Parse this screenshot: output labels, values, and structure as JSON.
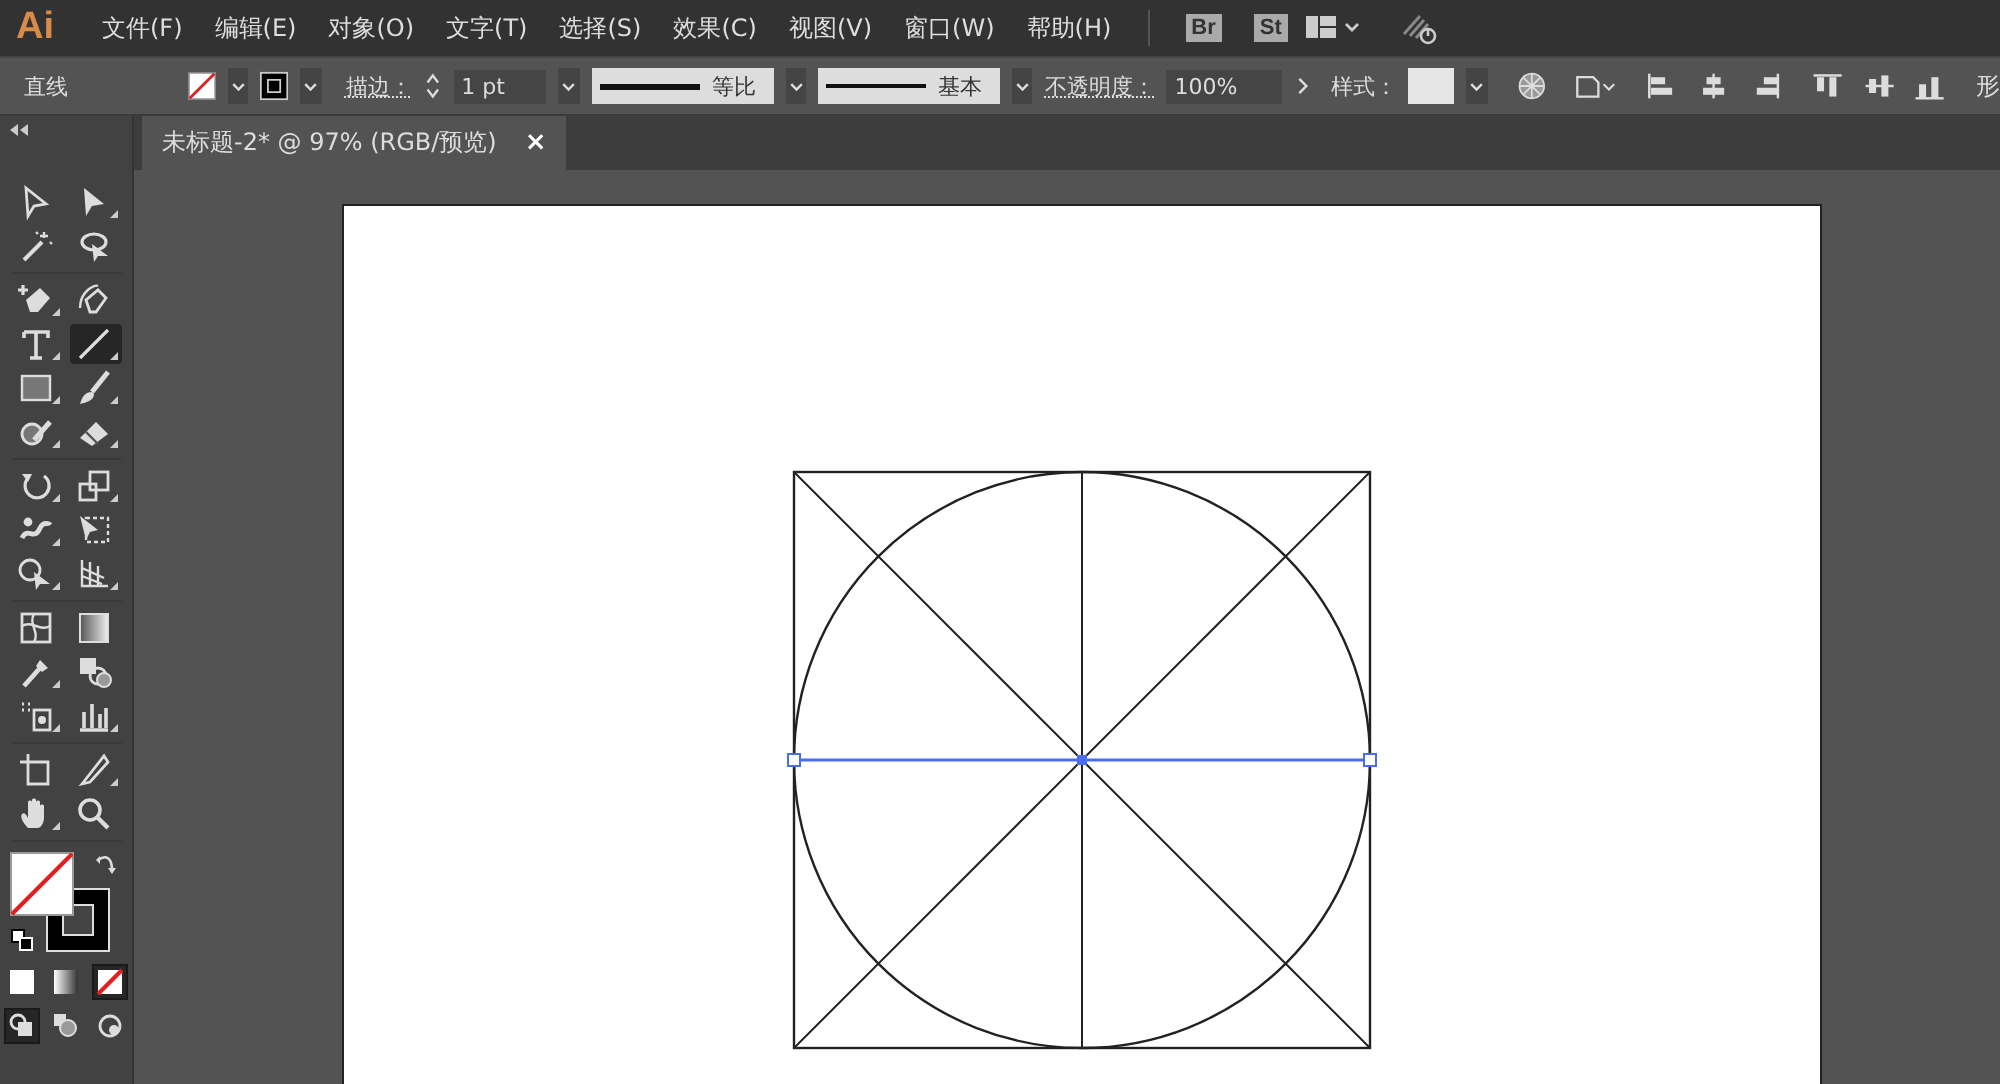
{
  "menubar": {
    "logo": "Ai",
    "menus": [
      "文件(F)",
      "编辑(E)",
      "对象(O)",
      "文字(T)",
      "选择(S)",
      "效果(C)",
      "视图(V)",
      "窗口(W)",
      "帮助(H)"
    ],
    "apps": [
      "Br",
      "St"
    ]
  },
  "control_bar": {
    "tool_name": "直线",
    "fill": {
      "kind": "none"
    },
    "stroke": {
      "kind": "solid"
    },
    "stroke_label": "描边：",
    "stroke_weight": "1 pt",
    "width_profile": "等比",
    "brush": "基本",
    "opacity_label": "不透明度：",
    "opacity": "100%",
    "style_label": "样式：",
    "cut_label": "形"
  },
  "document_tab": {
    "title": "未标题-2* @ 97% (RGB/预览)",
    "close": "×"
  },
  "tool_groups": [
    [
      {
        "kind": "select",
        "selected": false,
        "flyout": false
      },
      {
        "kind": "direct-select",
        "selected": false,
        "flyout": true
      },
      {
        "kind": "wand",
        "selected": false,
        "flyout": false
      },
      {
        "kind": "lasso",
        "selected": false,
        "flyout": false
      }
    ],
    [
      {
        "kind": "pen",
        "selected": false,
        "flyout": true
      },
      {
        "kind": "curvature",
        "selected": false,
        "flyout": false
      },
      {
        "kind": "type",
        "selected": false,
        "flyout": true
      },
      {
        "kind": "line",
        "selected": true,
        "flyout": true
      },
      {
        "kind": "rect",
        "selected": false,
        "flyout": true
      },
      {
        "kind": "brush",
        "selected": false,
        "flyout": true
      },
      {
        "kind": "shaper",
        "selected": false,
        "flyout": true
      },
      {
        "kind": "eraser",
        "selected": false,
        "flyout": true
      }
    ],
    [
      {
        "kind": "rotate",
        "selected": false,
        "flyout": true
      },
      {
        "kind": "scale",
        "selected": false,
        "flyout": true
      },
      {
        "kind": "warp",
        "selected": false,
        "flyout": true
      },
      {
        "kind": "free-transform",
        "selected": false,
        "flyout": false
      },
      {
        "kind": "shape-builder",
        "selected": false,
        "flyout": true
      },
      {
        "kind": "perspective",
        "selected": false,
        "flyout": true
      }
    ],
    [
      {
        "kind": "mesh",
        "selected": false,
        "flyout": false
      },
      {
        "kind": "gradient",
        "selected": false,
        "flyout": false
      },
      {
        "kind": "eyedropper",
        "selected": false,
        "flyout": true
      },
      {
        "kind": "blend",
        "selected": false,
        "flyout": false
      },
      {
        "kind": "symbol",
        "selected": false,
        "flyout": true
      },
      {
        "kind": "graph",
        "selected": false,
        "flyout": true
      }
    ],
    [
      {
        "kind": "artboard",
        "selected": false,
        "flyout": false
      },
      {
        "kind": "slice",
        "selected": false,
        "flyout": true
      },
      {
        "kind": "hand",
        "selected": false,
        "flyout": true
      },
      {
        "kind": "zoom",
        "selected": false,
        "flyout": false
      }
    ]
  ],
  "fill_stroke": {
    "fill": {
      "kind": "none"
    },
    "stroke": {
      "kind": "solid"
    }
  },
  "color_modes": [
    {
      "kind": "color",
      "selected": false
    },
    {
      "kind": "gradient",
      "selected": false
    },
    {
      "kind": "none",
      "selected": true
    }
  ],
  "draw_modes": [
    {
      "kind": "normal",
      "selected": true
    },
    {
      "kind": "behind",
      "selected": false
    },
    {
      "kind": "inside",
      "selected": false
    }
  ]
}
